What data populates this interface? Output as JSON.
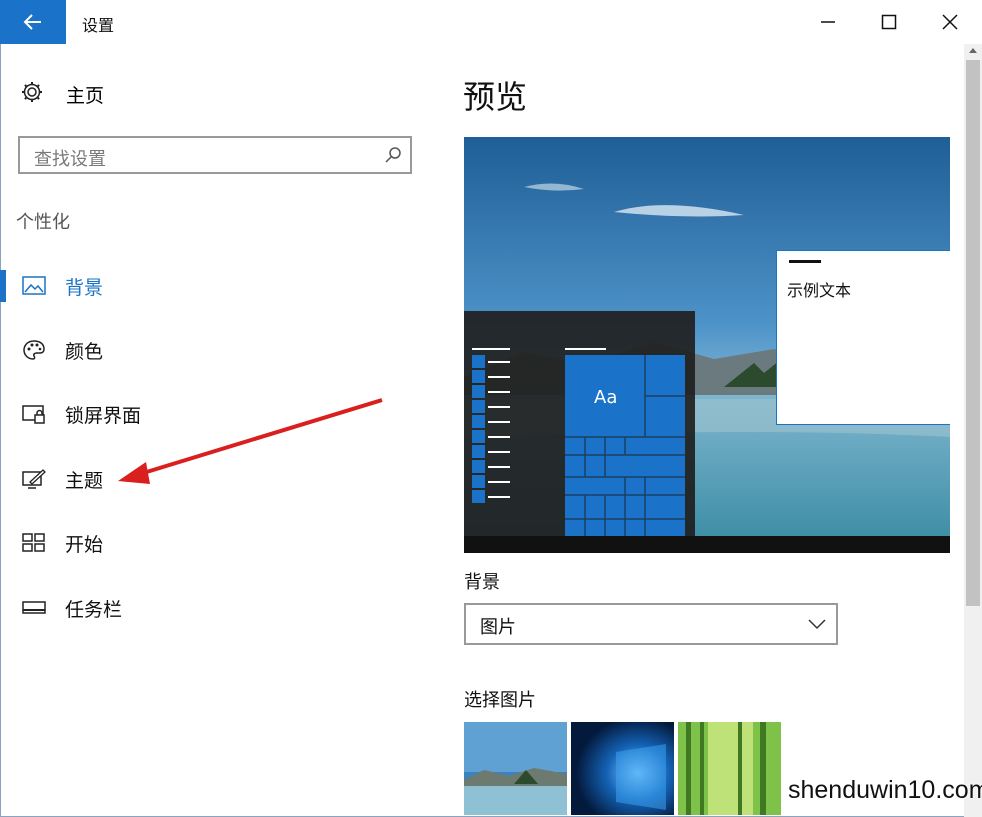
{
  "window": {
    "title": "设置"
  },
  "nav": {
    "home_label": "主页",
    "search_placeholder": "查找设置",
    "section_label": "个性化",
    "items": [
      {
        "label": "背景",
        "icon": "picture-icon",
        "active": true
      },
      {
        "label": "颜色",
        "icon": "palette-icon",
        "active": false
      },
      {
        "label": "锁屏界面",
        "icon": "lock-screen-icon",
        "active": false
      },
      {
        "label": "主题",
        "icon": "theme-icon",
        "active": false
      },
      {
        "label": "开始",
        "icon": "start-grid-icon",
        "active": false
      },
      {
        "label": "任务栏",
        "icon": "taskbar-icon",
        "active": false
      }
    ]
  },
  "main": {
    "title": "预览",
    "preview": {
      "sample_text": "示例文本",
      "tile_label": "Aa"
    },
    "background_label": "背景",
    "background_value": "图片",
    "choose_picture_label": "选择图片"
  },
  "watermark": "shenduwin10.com",
  "colors": {
    "accent": "#1a73c8",
    "annotation_arrow": "#d9201e"
  }
}
